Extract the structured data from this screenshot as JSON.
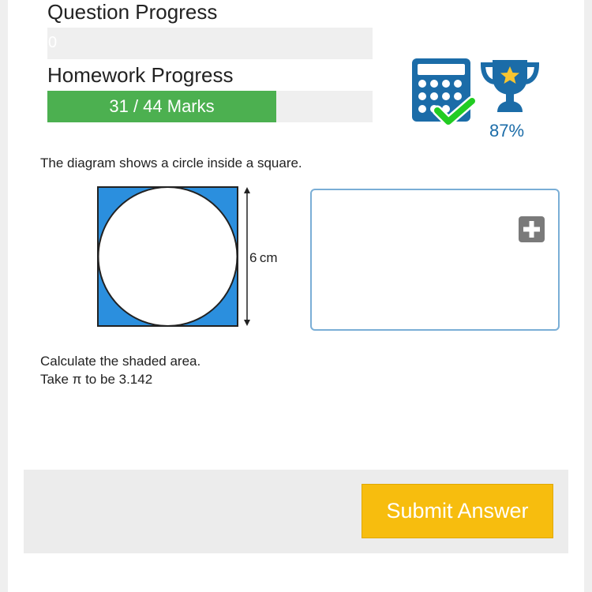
{
  "question_progress": {
    "label": "Question Progress",
    "value": "0"
  },
  "homework_progress": {
    "label": "Homework Progress",
    "marks_text": "31 / 44 Marks",
    "scored": 31,
    "total": 44,
    "fill_fraction": 0.7045
  },
  "score": {
    "percent_text": "87%",
    "icons": [
      "calculator-check-icon",
      "trophy-star-icon"
    ]
  },
  "question": {
    "intro": "The diagram shows a circle inside a square.",
    "instruction": "Calculate the shaded area.",
    "pi_note": "Take π to be 3.142"
  },
  "diagram": {
    "dimension_label": "6 cm",
    "shaded_color": "#2b8fde",
    "description_colors": {
      "circle": "#ffffff"
    }
  },
  "answer": {
    "value": ""
  },
  "footer": {
    "submit_label": "Submit Answer"
  },
  "colors": {
    "progress_fill": "#4cb050",
    "submit": "#f7bd0e",
    "accent_blue": "#1b6ca8"
  }
}
